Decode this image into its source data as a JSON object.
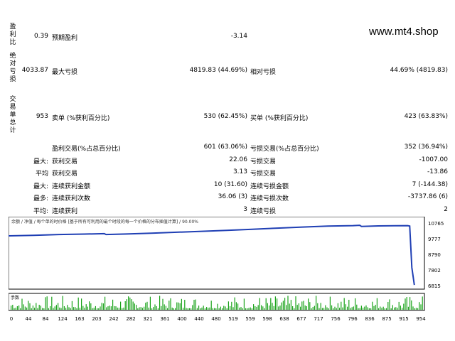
{
  "brand": "www.mt4.shop",
  "side_labels": {
    "profit_factor": [
      "盈",
      "利",
      "比"
    ],
    "absolute_dd": [
      "绝",
      "对",
      "亏",
      "损"
    ],
    "total_trades": [
      "交",
      "易",
      "单",
      "总",
      "计"
    ]
  },
  "stats": {
    "profit_factor_value": "0.39",
    "expected_payoff_label": "预期盈利",
    "expected_payoff_value": "-3.14",
    "absolute_dd_value": "4033.87",
    "max_dd_label": "最大亏损",
    "max_dd_value": "4819.83 (44.69%)",
    "rel_dd_label": "相对亏损",
    "rel_dd_value": "44.69% (4819.83)",
    "total_trades_value": "953",
    "short_label": "卖单 (%获利百分比)",
    "short_value": "530 (62.45%)",
    "long_label": "买单 (%获利百分比)",
    "long_value": "423 (63.83%)",
    "profit_trades_label": "盈利交易(%占总百分比)",
    "profit_trades_value": "601 (63.06%)",
    "loss_trades_label": "亏损交易(%占总百分比)",
    "loss_trades_value": "352 (36.94%)",
    "row_max": "最大:",
    "largest_profit_label": "获利交易",
    "largest_profit_value": "22.06",
    "largest_loss_label": "亏损交易",
    "largest_loss_value": "-1007.00",
    "row_avg": "平均",
    "avg_profit_label": "获利交易",
    "avg_profit_value": "3.13",
    "avg_loss_label": "亏损交易",
    "avg_loss_value": "-13.86",
    "row_max2": "最大:",
    "max_consec_wins_label": "连续获利金额",
    "max_consec_wins_value": "10 (31.60)",
    "max_consec_losses_label": "连续亏损金额",
    "max_consec_losses_value": "7 (-144.38)",
    "row_most": "最多:",
    "max_consec_profit_label": "连续获利次数",
    "max_consec_profit_value": "36.06 (3)",
    "max_consec_loss_label": "连续亏损次数",
    "max_consec_loss_value": "-3737.86 (6)",
    "row_avg2": "平均:",
    "avg_consec_wins_label": "连续获利",
    "avg_consec_wins_value": "3",
    "avg_consec_losses_label": "连续亏损",
    "avg_consec_losses_value": "2"
  },
  "chart_data": {
    "type": "line",
    "legend_text": "余额 / 净值 / 每个单的时价格 [基于所有可利用的最个时段的每一个价格的分布插值计算] / 90.00%",
    "volume_label": "手数",
    "y_ticks": [
      "10765",
      "9777",
      "8790",
      "7802",
      "6815"
    ],
    "ylim": [
      6815,
      10765
    ],
    "x_ticks": [
      "0",
      "44",
      "84",
      "124",
      "163",
      "203",
      "242",
      "282",
      "321",
      "361",
      "400",
      "440",
      "480",
      "519",
      "559",
      "598",
      "638",
      "677",
      "717",
      "756",
      "796",
      "836",
      "875",
      "915",
      "954"
    ],
    "xlim": [
      0,
      990
    ],
    "balance_series": [
      {
        "x": 0,
        "y": 10000
      },
      {
        "x": 60,
        "y": 10040
      },
      {
        "x": 120,
        "y": 10085
      },
      {
        "x": 180,
        "y": 10115
      },
      {
        "x": 228,
        "y": 10140
      },
      {
        "x": 232,
        "y": 10085
      },
      {
        "x": 280,
        "y": 10120
      },
      {
        "x": 340,
        "y": 10170
      },
      {
        "x": 400,
        "y": 10230
      },
      {
        "x": 460,
        "y": 10290
      },
      {
        "x": 520,
        "y": 10350
      },
      {
        "x": 580,
        "y": 10420
      },
      {
        "x": 640,
        "y": 10490
      },
      {
        "x": 700,
        "y": 10560
      },
      {
        "x": 760,
        "y": 10620
      },
      {
        "x": 820,
        "y": 10650
      },
      {
        "x": 836,
        "y": 10670
      },
      {
        "x": 840,
        "y": 10600
      },
      {
        "x": 880,
        "y": 10630
      },
      {
        "x": 920,
        "y": 10640
      },
      {
        "x": 950,
        "y": 10650
      },
      {
        "x": 955,
        "y": 10620
      },
      {
        "x": 960,
        "y": 8000
      },
      {
        "x": 966,
        "y": 6900
      }
    ],
    "colors": {
      "balance": "#1f3fb4",
      "volume": "#1aa31a",
      "axis": "#000000"
    }
  }
}
